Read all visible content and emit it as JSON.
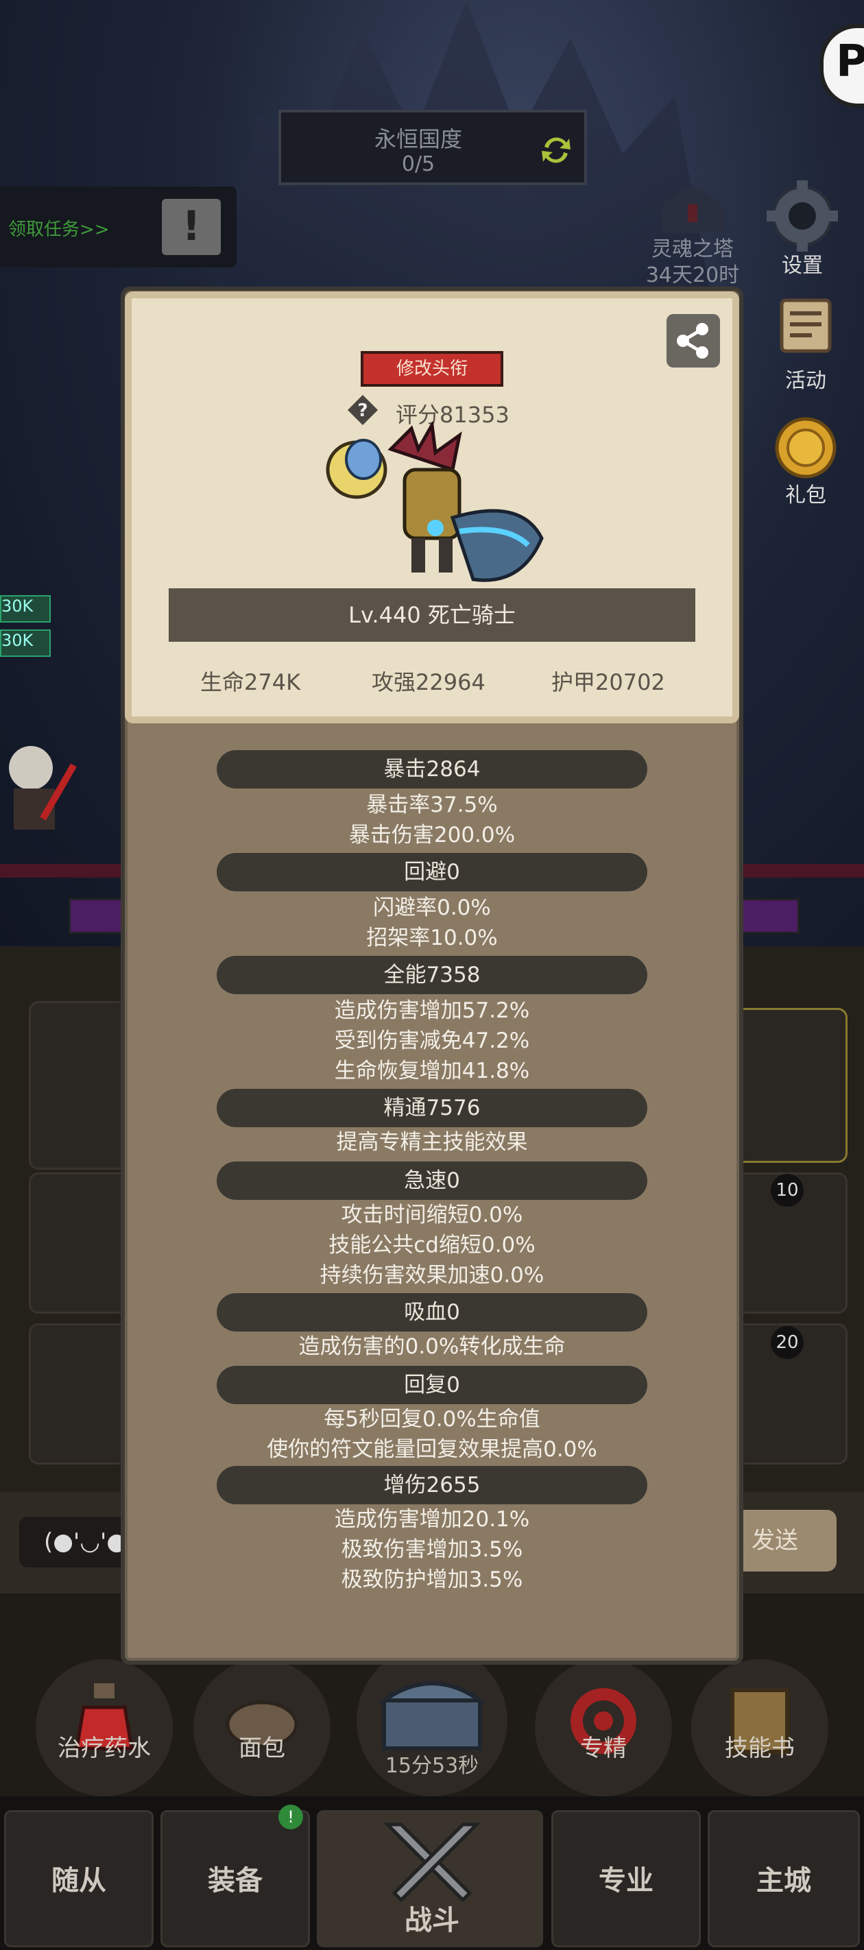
{
  "header": {
    "eternal_title": "永恒国度",
    "eternal_count": "0/5",
    "claim_task": "领取任务>>",
    "tower_name": "灵魂之塔",
    "tower_timer": "34天20时"
  },
  "side_menu": {
    "settings": "设置",
    "events": "活动",
    "gift": "礼包"
  },
  "left_tags": [
    "30K",
    "30K"
  ],
  "profile": {
    "change_title_label": "修改头衔",
    "score": "评分81353",
    "level_class": "Lv.440 死亡骑士",
    "hp": "生命274K",
    "attack": "攻强22964",
    "armor": "护甲20702"
  },
  "stats": [
    {
      "header": "暴击2864",
      "lines": [
        "暴击率37.5%",
        "暴击伤害200.0%"
      ]
    },
    {
      "header": "回避0",
      "lines": [
        "闪避率0.0%",
        "招架率10.0%"
      ]
    },
    {
      "header": "全能7358",
      "lines": [
        "造成伤害增加57.2%",
        "受到伤害减免47.2%",
        "生命恢复增加41.8%"
      ]
    },
    {
      "header": "精通7576",
      "lines": [
        "提高专精主技能效果"
      ]
    },
    {
      "header": "急速0",
      "lines": [
        "攻击时间缩短0.0%",
        "技能公共cd缩短0.0%",
        "持续伤害效果加速0.0%"
      ]
    },
    {
      "header": "吸血0",
      "lines": [
        "造成伤害的0.0%转化成生命"
      ]
    },
    {
      "header": "回复0",
      "lines": [
        "每5秒回复0.0%生命值",
        "使你的符文能量回复效果提高0.0%"
      ]
    },
    {
      "header": "增伤2655",
      "lines": [
        "造成伤害增加20.1%",
        "极致伤害增加3.5%",
        "极致防护增加3.5%"
      ]
    }
  ],
  "inventory": {
    "slot_counts": [
      "10",
      "20"
    ]
  },
  "chat": {
    "emoji": "(●'◡'●",
    "send": "发送"
  },
  "quick_items": [
    "治疗药水",
    "面包",
    "专精",
    "技能书"
  ],
  "chest_timer": "15分53秒",
  "nav": {
    "tabs": [
      "随从",
      "装备",
      "战斗",
      "专业",
      "主城"
    ],
    "badge": "!"
  },
  "colors": {
    "title_button": "#c4312d",
    "panel": "#8a7a64",
    "card": "#e9dfc6",
    "stat_header": "#3b3832"
  }
}
